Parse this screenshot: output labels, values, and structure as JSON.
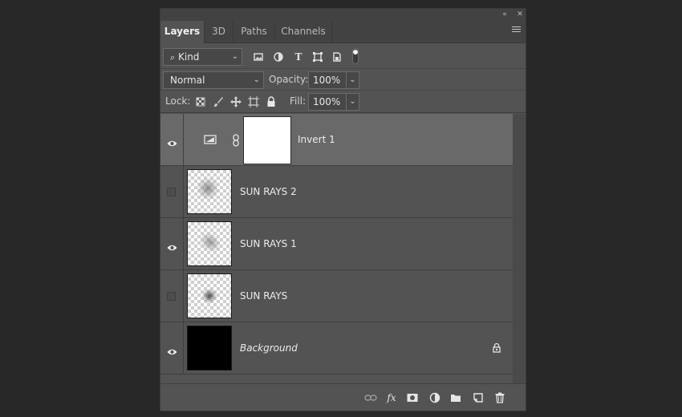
{
  "titlebar": {
    "collapse_glyph": "«",
    "close_glyph": "✕"
  },
  "tabs": [
    {
      "label": "Layers",
      "active": true
    },
    {
      "label": "3D",
      "active": false
    },
    {
      "label": "Paths",
      "active": false
    },
    {
      "label": "Channels",
      "active": false
    }
  ],
  "filter": {
    "kind_label": "Kind",
    "icons": [
      "pixel-filter-icon",
      "adjustment-filter-icon",
      "type-filter-icon",
      "shape-filter-icon",
      "smart-object-filter-icon",
      "filter-toggle"
    ]
  },
  "blend": {
    "mode": "Normal",
    "opacity_label": "Opacity:",
    "opacity_value": "100%"
  },
  "lock": {
    "label": "Lock:",
    "fill_label": "Fill:",
    "fill_value": "100%"
  },
  "layers": [
    {
      "name": "Invert 1",
      "visible": true,
      "selected": true,
      "type": "adjustment",
      "italic": false,
      "locked": false
    },
    {
      "name": "SUN RAYS 2",
      "visible": false,
      "selected": false,
      "type": "pixel",
      "italic": false,
      "locked": false
    },
    {
      "name": "SUN RAYS 1",
      "visible": true,
      "selected": false,
      "type": "pixel",
      "italic": false,
      "locked": false
    },
    {
      "name": "SUN RAYS",
      "visible": false,
      "selected": false,
      "type": "pixel",
      "italic": false,
      "locked": false
    },
    {
      "name": "Background",
      "visible": true,
      "selected": false,
      "type": "background",
      "italic": true,
      "locked": true
    }
  ],
  "bottom_icons": [
    "link-layers-icon",
    "fx-icon",
    "add-mask-icon",
    "new-adjustment-icon",
    "new-group-icon",
    "new-layer-icon",
    "delete-layer-icon"
  ],
  "bottom_fx_label": "fx",
  "colors": {
    "panel_bg": "#535353",
    "selected_row": "#696969",
    "app_bg": "#282828"
  }
}
